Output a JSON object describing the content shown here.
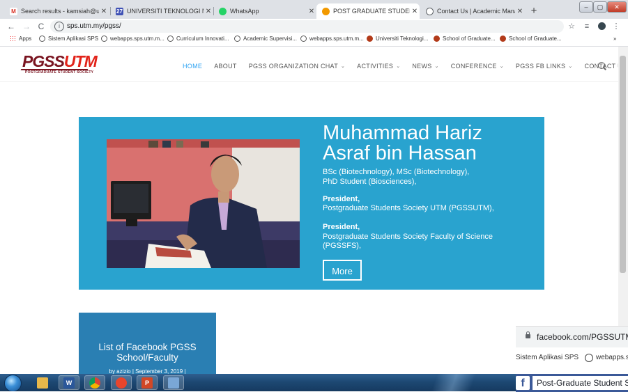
{
  "browser": {
    "tabs": [
      {
        "title": "Search results - kamsiah@utmm",
        "favicon": "gmail-icon",
        "color": "#d93025"
      },
      {
        "title": "UNIVERSITI TEKNOLOGI MALAYSI",
        "favicon": "utm-portal-icon",
        "color": "#3f51b5"
      },
      {
        "title": "WhatsApp",
        "favicon": "whatsapp-icon",
        "color": "#25d366"
      },
      {
        "title": "POST GRADUATE STUDENT SOC",
        "favicon": "pgss-icon",
        "color": "#f29900"
      },
      {
        "title": "Contact Us | Academic Managem",
        "favicon": "globe-icon",
        "color": "#5f6368"
      }
    ],
    "new_tab": "+",
    "window_controls": {
      "minimize": "–",
      "maximize": "▢",
      "close": "✕"
    },
    "url": "sps.utm.my/pgss/",
    "toolbar_icons": [
      "star-icon",
      "extension-icon",
      "profile-icon",
      "menu-icon"
    ]
  },
  "bookmarks": [
    {
      "label": "Apps",
      "icon": "apps"
    },
    {
      "label": "Sistem Aplikasi SPS",
      "icon": "globe"
    },
    {
      "label": "webapps.sps.utm.m...",
      "icon": "globe"
    },
    {
      "label": "Curriculum Innovati...",
      "icon": "globe"
    },
    {
      "label": "Academic Supervisi...",
      "icon": "globe"
    },
    {
      "label": "webapps.sps.utm.m...",
      "icon": "globe"
    },
    {
      "label": "Universiti Teknologi...",
      "icon": "utm"
    },
    {
      "label": "School of Graduate...",
      "icon": "utm"
    },
    {
      "label": "School of Graduate...",
      "icon": "utm"
    }
  ],
  "bookmarks_overflow": "»",
  "site": {
    "logo": {
      "part1": "PGSS",
      "part2": "UTM",
      "tagline": "POSTGRADUATE STUDENT SOCIETY"
    },
    "nav": [
      {
        "label": "HOME",
        "dropdown": false
      },
      {
        "label": "ABOUT",
        "dropdown": false
      },
      {
        "label": "PGSS ORGANIZATION CHAT",
        "dropdown": true
      },
      {
        "label": "ACTIVITIES",
        "dropdown": true
      },
      {
        "label": "NEWS",
        "dropdown": true
      },
      {
        "label": "CONFERENCE",
        "dropdown": true
      },
      {
        "label": "PGSS FB LINKS",
        "dropdown": true
      },
      {
        "label": "CONTACT US",
        "dropdown": false
      }
    ],
    "accent_color": "#2ea3f2",
    "hero": {
      "background": "#29a3cf",
      "name": "Muhammad Hariz Asraf bin Hassan",
      "degrees": "BSc (Biotechnology), MSc (Biotechnology),",
      "status": "PhD Student (Biosciences),",
      "role1_title": "President,",
      "role1_org": "Postgraduate Students Society UTM (PGSSUTM),",
      "role2_title": "President,",
      "role2_org": "Postgraduate Students Society Faculty of Science (PGSSFS),",
      "button": "More"
    },
    "post": {
      "title": "List of Facebook PGSS School/Faculty",
      "meta": "by azizio | September 3, 2019 |"
    }
  },
  "facebook_window": {
    "url": "facebook.com/PGSSUTM/",
    "bookmark1": "Sistem Aplikasi SPS",
    "bookmark2": "webapps.s",
    "page_name": "Post-Graduate Student S"
  },
  "taskbar": {
    "apps": [
      {
        "name": "explorer",
        "label": "",
        "color": "#e8b84a"
      },
      {
        "name": "word",
        "label": "W",
        "color": "#2b579a"
      },
      {
        "name": "chrome",
        "label": "",
        "color": "#4caf50"
      },
      {
        "name": "app-red",
        "label": "",
        "color": "#e8452c"
      },
      {
        "name": "powerpoint",
        "label": "P",
        "color": "#d24726"
      },
      {
        "name": "window",
        "label": "",
        "color": "#7aa7d6"
      }
    ]
  }
}
